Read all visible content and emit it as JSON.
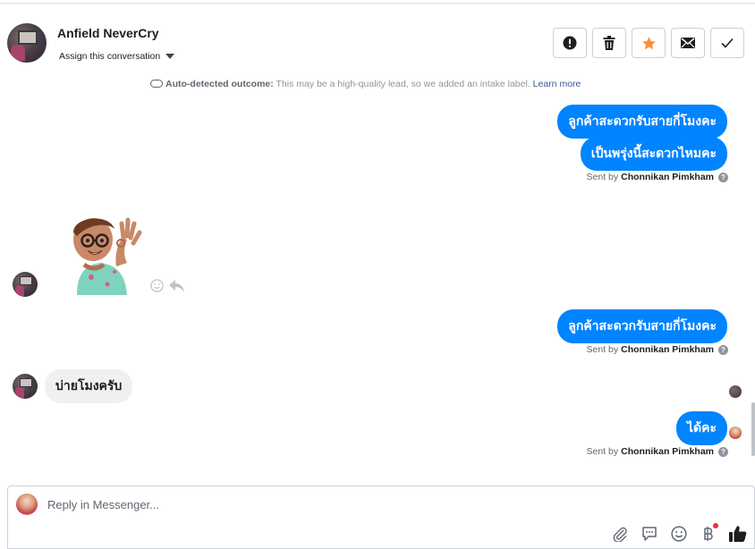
{
  "header": {
    "contact_name": "Anfield NeverCry",
    "assign_label": "Assign this conversation",
    "actions": [
      {
        "name": "spam-button",
        "icon": "exclamation-icon"
      },
      {
        "name": "delete-button",
        "icon": "trash-icon"
      },
      {
        "name": "star-button",
        "icon": "star-icon",
        "color": "#f7923b"
      },
      {
        "name": "mark-unread-button",
        "icon": "envelope-icon"
      },
      {
        "name": "mark-done-button",
        "icon": "check-icon"
      }
    ]
  },
  "conversation": {
    "outcome_label": "Auto-detected outcome:",
    "outcome_text": " This may be a high-quality lead, so we added an intake label.",
    "outcome_link": "Learn more",
    "messages": [
      {
        "text": "ลูกค้าสะดวกรับสายกี่โมงคะ"
      },
      {
        "text": "เป็นพรุ่งนี้สะดวกไหมคะ"
      },
      {
        "text": "ลูกค้าสะดวกรับสายกี่โมงคะ"
      },
      {
        "text": "บ่ายโมงครับ"
      },
      {
        "text": "ได้คะ"
      }
    ],
    "sent_by_prefix": "Sent by ",
    "sent_by_name": "Chonnikan Pimkham",
    "help_mark": "?",
    "outgoing_color": "#0084ff",
    "incoming_color": "#f1f0f0"
  },
  "composer": {
    "placeholder": "Reply in Messenger...",
    "tools": [
      "paperclip-icon",
      "quick-reply-icon",
      "emoji-icon",
      "baht-payment-icon",
      "thumbs-up-icon"
    ],
    "accent_color": "#1c1e21"
  }
}
